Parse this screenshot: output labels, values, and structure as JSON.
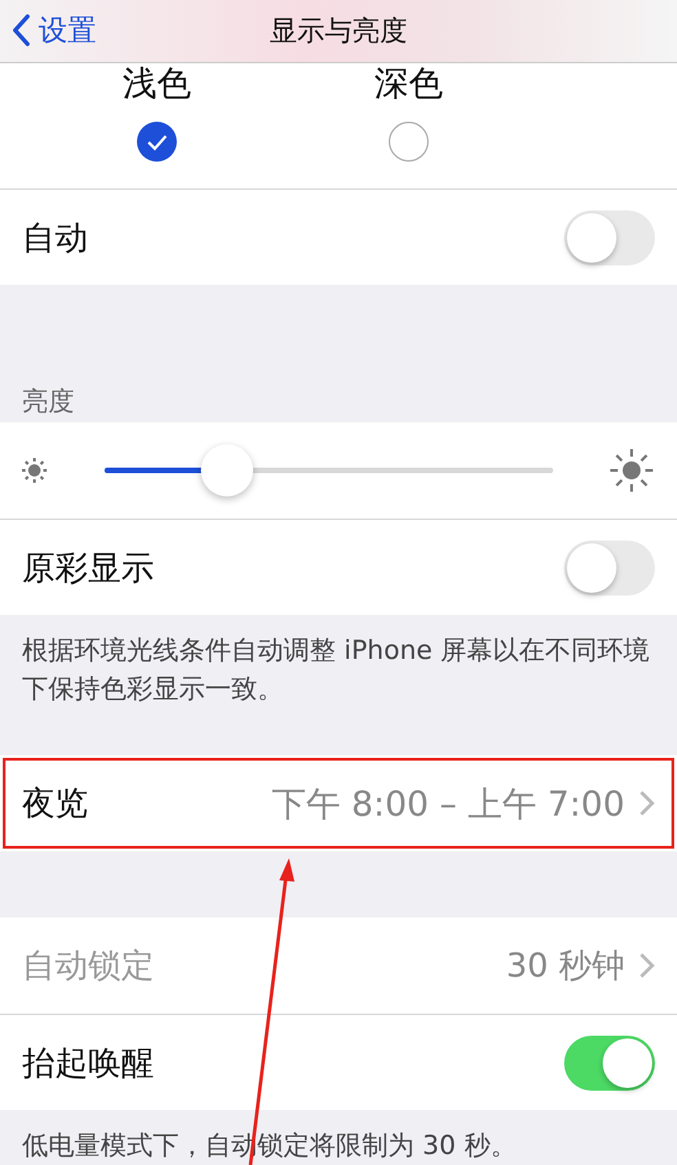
{
  "nav": {
    "back": "设置",
    "title": "显示与亮度"
  },
  "appearance": {
    "options": [
      {
        "label": "浅色",
        "selected": true
      },
      {
        "label": "深色",
        "selected": false
      }
    ],
    "auto": {
      "label": "自动",
      "on": false
    }
  },
  "brightness": {
    "header": "亮度",
    "level": 0.3,
    "true_tone": {
      "label": "原彩显示",
      "on": false
    },
    "footer": "根据环境光线条件自动调整 iPhone 屏幕以在不同环境下保持色彩显示一致。"
  },
  "night_shift": {
    "label": "夜览",
    "value": "下午 8:00 – 上午 7:00",
    "highlighted": true
  },
  "lock": [
    {
      "kind": "link",
      "label": "自动锁定",
      "value": "30 秒钟",
      "disabled": true
    },
    {
      "kind": "toggle",
      "label": "抬起唤醒",
      "on": true
    }
  ],
  "lock_footer": "低电量模式下，自动锁定将限制为 30 秒。"
}
